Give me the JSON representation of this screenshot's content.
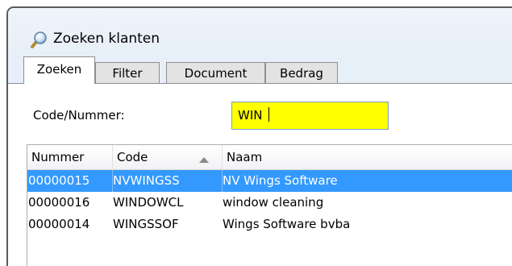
{
  "window": {
    "title": "Zoeken klanten",
    "title_icon": "search-magnifier-icon"
  },
  "tabs": [
    {
      "label": "Zoeken",
      "active": true
    },
    {
      "label": "Filter",
      "active": false
    },
    {
      "label": "Document",
      "active": false
    },
    {
      "label": "Bedrag",
      "active": false
    }
  ],
  "search": {
    "code_label": "Code/Nummer:",
    "code_value": "WIN ",
    "field_color": "#ffff00"
  },
  "grid": {
    "columns": [
      {
        "label": "Nummer"
      },
      {
        "label": "Code",
        "sorted": "ascending"
      },
      {
        "label": "Naam"
      }
    ],
    "rows": [
      {
        "nummer": "00000015",
        "code": "NVWINGSS",
        "naam": "NV Wings Software",
        "selected": true
      },
      {
        "nummer": "00000016",
        "code": "WINDOWCL",
        "naam": "window cleaning",
        "selected": false
      },
      {
        "nummer": "00000014",
        "code": "WINGSSOF",
        "naam": "Wings Software bvba",
        "selected": false
      }
    ],
    "selection_color": "#3399ff"
  }
}
